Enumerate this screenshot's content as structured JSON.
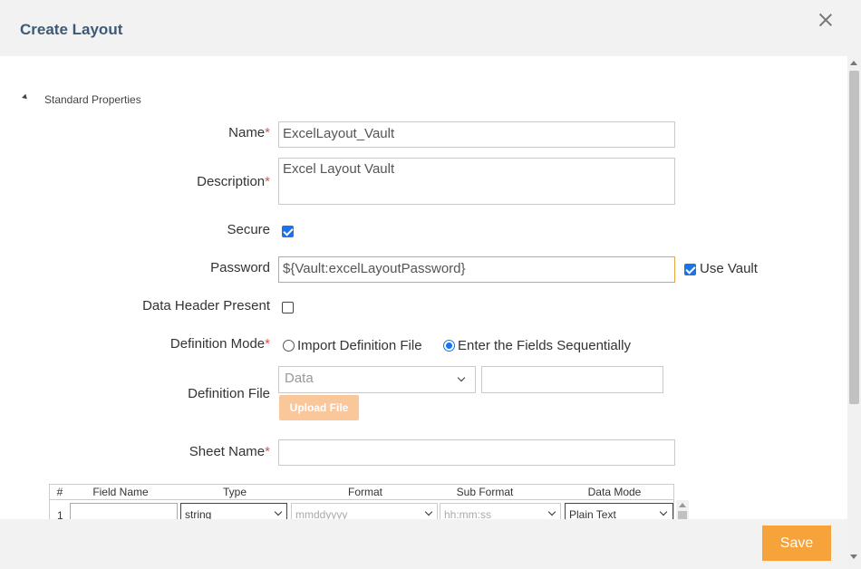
{
  "dialog": {
    "title": "Create Layout"
  },
  "section": {
    "title": "Standard Properties"
  },
  "fields": {
    "name": {
      "label": "Name",
      "required": "*",
      "value": "ExcelLayout_Vault"
    },
    "description": {
      "label": "Description",
      "required": "*",
      "value": "Excel Layout Vault"
    },
    "secure": {
      "label": "Secure"
    },
    "password": {
      "label": "Password",
      "value": "${Vault:excelLayoutPassword}",
      "use_vault_label": "Use Vault"
    },
    "data_header": {
      "label": "Data Header Present"
    },
    "definition_mode": {
      "label": "Definition Mode",
      "required": "*",
      "option_import": "Import Definition File",
      "option_sequential": "Enter the Fields Sequentially"
    },
    "definition_file": {
      "label": "Definition File",
      "select_value": "Data",
      "upload_label": "Upload File"
    },
    "sheet_name": {
      "label": "Sheet Name",
      "required": "*"
    }
  },
  "grid": {
    "headers": [
      "#",
      "Field Name",
      "Type",
      "Format",
      "Sub Format",
      "Data Mode"
    ],
    "rows": [
      {
        "num": "1",
        "field_name": "",
        "type": "string",
        "format": "mmddyyyy",
        "sub_format": "hh:mm:ss",
        "data_mode": "Plain Text"
      }
    ]
  },
  "footer": {
    "save_label": "Save"
  }
}
